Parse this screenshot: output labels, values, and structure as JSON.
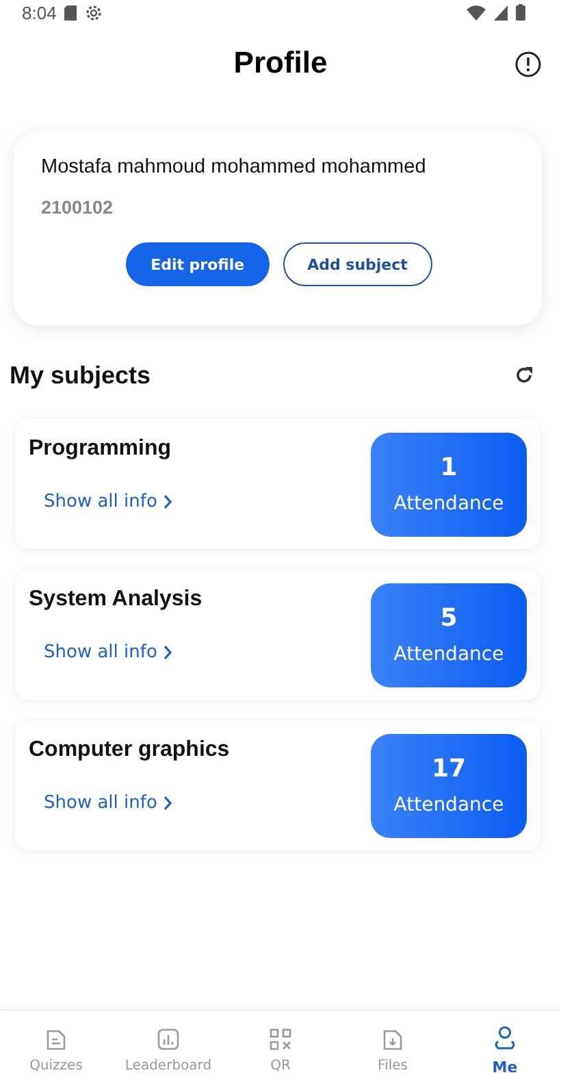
{
  "status_bar": {
    "time": "8:04"
  },
  "header": {
    "title": "Profile"
  },
  "profile": {
    "name": "Mostafa mahmoud mohammed mohammed",
    "id": "2100102",
    "buttons": [
      {
        "label": "Edit profile",
        "kind": "primary"
      },
      {
        "label": "Add subject",
        "kind": "outline"
      }
    ]
  },
  "subjects_section": {
    "title": "My subjects"
  },
  "subjects": [
    {
      "name": "Programming",
      "link": "Show all info",
      "count": "1",
      "count_label": "Attendance"
    },
    {
      "name": "System Analysis",
      "link": "Show all info",
      "count": "5",
      "count_label": "Attendance"
    },
    {
      "name": "Computer graphics",
      "link": "Show all info",
      "count": "17",
      "count_label": "Attendance"
    }
  ],
  "bottom_nav": [
    {
      "label": "Quizzes",
      "kind": "quiz",
      "selected": false
    },
    {
      "label": "Leaderboard",
      "kind": "chart",
      "selected": false
    },
    {
      "label": "QR",
      "kind": "qr",
      "selected": false
    },
    {
      "label": "Files",
      "kind": "file",
      "selected": false
    },
    {
      "label": "Me",
      "kind": "person",
      "selected": true
    }
  ]
}
